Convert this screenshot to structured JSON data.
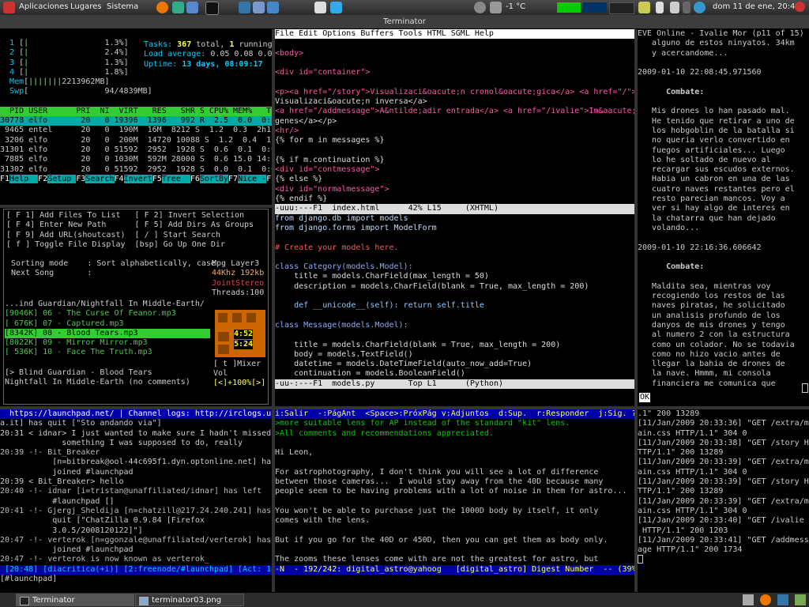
{
  "panel": {
    "menus": [
      "Aplicaciones",
      "Lugares",
      "Sistema"
    ],
    "temperature": "-1 °C",
    "clock": "dom 11 de ene, 20:48"
  },
  "window_title": "Terminator",
  "taskbar": {
    "tasks": [
      "Terminator",
      "terminator03.png"
    ]
  },
  "htop": {
    "cpus": [
      {
        "n": "1",
        "pct": "1.3%"
      },
      {
        "n": "2",
        "pct": "2.4%"
      },
      {
        "n": "3",
        "pct": "1.3%"
      },
      {
        "n": "4",
        "pct": "1.8%"
      }
    ],
    "mem": "3962MB",
    "mem_pre": "221",
    "swp": "94/4839MB",
    "tasks_label": "Tasks:",
    "tasks_total": "367",
    "tasks_mid": " total, ",
    "tasks_running": "1",
    "tasks_end": " running",
    "load_label": "Load average:",
    "load": "0.05 0.08 0.0",
    "uptime_label": "Uptime:",
    "uptime": "13 days, 08:09:17",
    "header": "  PID USER      PRI  NI  VIRT   RES   SHR S CPU% MEM%   TIME",
    "rows": [
      "30778 elfo       20   0 19396  1396   992 R  2.5  0.0  0:36",
      " 9465 entel      20   0  190M  16M  8212 S  1.2  0.3  2h11",
      " 3206 elfo       20   0  200M  14720 10088 S  1.2  0.4  1h57",
      "31301 elfo       20   0 51592  2952  1928 S  0.6  0.1  0:08",
      " 7885 elfo       20   0 1030M  592M 28000 S  0.6 15.0 14:10",
      "31302 elfo       20   0 51592  2952  1928 S  0.0  0.1  0:07"
    ],
    "fkeys": [
      {
        "k": "F1",
        "l": "Help  "
      },
      {
        "k": "F2",
        "l": "Setup "
      },
      {
        "k": "F3",
        "l": "Search"
      },
      {
        "k": "F4",
        "l": "Invert"
      },
      {
        "k": "F5",
        "l": "Tree  "
      },
      {
        "k": "F6",
        "l": "SortBy"
      },
      {
        "k": "F7",
        "l": "Nice -"
      },
      {
        "k": "F8",
        "l": ""
      }
    ]
  },
  "player": {
    "menu": [
      "[ F 1] Add Files To List   [ F 2] Invert Selection",
      "[ F 4] Enter New Path      [ F 5] Add Dirs As Groups",
      "[ F 9] Add URL(shoutcast)  [ / ] Start Search",
      "[ f ] Toggle File Display  [bsp] Go Up One Dir"
    ],
    "sorting": " Sorting mode    : Sort alphabetically, case",
    "next": " Next Song       :",
    "dir": "...ind Guardian/Nightfall In Middle-Earth/",
    "songs": [
      "[9046K] 06 - The Curse Of Feanor.mp3",
      "[ 676K] 07 - Captured.mp3",
      "[8342K] 08 - Blood Tears.mp3",
      "[8022K] 09 - Mirror Mirror.mp3",
      "[ 536K] 10 - Face The Truth.mp3"
    ],
    "selected_index": 2,
    "now1": "[> Blind Guardian - Blood Tears",
    "now2": "Nightfall In Middle-Earth (no comments)",
    "codec": [
      "Mpg Layer3",
      "44Khz 192kb",
      "JointStereo",
      "Threads:100"
    ],
    "elapsed": "4:52",
    "remain": "5:24",
    "mixer": "[ t ]Mixer",
    "vol_label": "Vol",
    "vol": "[<]+100%[>]"
  },
  "emacs": {
    "menubar": "File Edit Options Buffers Tools HTML SGML Help",
    "html_lines": [
      "",
      "<body>",
      "",
      "<div id=\"container\">",
      "",
      "<p><a href=\"/story\">Visualizaci&oacute;n cronol&oacute;gica</a> <a href=\"/\">\\",
      "Visualizaci&oacute;n inversa</a>",
      "<a href=\"/addmessage\">A&ntilde;adir entrada</a> <a href=\"/ivalie\">Im&aacute;\\",
      "genes</a></p>",
      "<hr/>",
      "{% for m in messages %}",
      "",
      "{% if m.continuation %}",
      "<div id=\"contmessage\">",
      "{% else %}",
      "<div id=\"normalmessage\">",
      "{% endif %}"
    ],
    "mode1": "-uuu:---F1  index.html      42% L15     (XHTML)",
    "py_lines": [
      "from django.db import models",
      "from django.forms import ModelForm",
      "",
      "# Create your models here.",
      "",
      "class Category(models.Model):",
      "    title = models.CharField(max_length = 50)",
      "    description = models.CharField(blank = True, max_length = 200)",
      "",
      "    def __unicode__(self): return self.title",
      "",
      "class Message(models.Model):",
      "",
      "    title = models.CharField(blank = True, max_length = 200)",
      "    body = models.TextField()",
      "    datetime = models.DateTimeField(auto_now_add=True)",
      "    continuation = models.BooleanField()"
    ],
    "mode2": "-uu-:---F1  models.py       Top L1      (Python)"
  },
  "eve": {
    "lines": [
      "EVE Online - Ivalie Mor (p11 of 15)",
      "   alguno de estos ninyatos. 34km",
      "   y acercandome...",
      "",
      "2009-01-10 22:08:45.971560",
      "",
      "      Combate:",
      "",
      "   Mis drones lo han pasado mal.",
      "   He tenido que retirar a uno de",
      "   los hobgoblin de la batalla si",
      "   no queria verlo convertido en",
      "   fuegos artificiales... Luego",
      "   lo he soltado de nuevo al",
      "   recargar sus escudos externos.",
      "   Habia un cabron en una de las",
      "   cuatro naves restantes pero el",
      "   resto parecian mancos. Voy a",
      "   ver si hay algo de interes en",
      "   la chatarra que han dejado",
      "   volando...",
      "",
      "2009-01-10 22:16:36.606642",
      "",
      "      Combate:",
      "",
      "   Maldita sea, mientras voy",
      "   recogiendo los restos de las",
      "   naves piratas, he solicitado",
      "   un analisis profundo de los",
      "   danyos de mis drones y tengo",
      "   al numero 2 con la estructura",
      "   como un colador. No se todavia",
      "   como no hizo vacio antes de",
      "   llegar la bahia de drones de",
      "   la nave. Hmmm, mi consola",
      "   financiera me comunica que"
    ],
    "ok": "OK"
  },
  "irc": {
    "topic": "  https://launchpad.net/ | Channel logs: http://irclogs.ub",
    "lines": [
      "a.it] has quit [\"Sto andando via\"]",
      "20:31 < idnar> I just wanted to make sure I hadn't missed",
      "             something I was supposed to do, really",
      "20:39 -!- Bit_Breaker",
      "           [n=bitbreak@ool-44c695f1.dyn.optonline.net] has",
      "           joined #launchpad",
      "20:39 < Bit_Breaker> hello",
      "20:40 -!- idnar [i=tristan@unaffiliated/idnar] has left",
      "           #launchpad []",
      "20:41 -!- Gjergj_Sheldija [n=chatzill@217.24.240.241] has",
      "           quit [\"ChatZilla 0.9.84 [Firefox",
      "           3.0.5/2008120122]\"]",
      "20:47 -!- verterok [n=ggonzale@unaffiliated/verterok] has",
      "           joined #launchpad",
      "20:47 -!- verterok is now known as verterok_"
    ],
    "status": " [20:48] [diacritica(+i)] [2:freenode/#launchpad] [Act: 1]",
    "input": "[#launchpad] "
  },
  "mutt": {
    "top": "i:Salir  -:PágAnt  <Space>:PróxPág v:Adjuntos  d:Sup.  r:Responder  j:Sig. ?:",
    "lines": [
      ">more suitable lens for AP instead of the standard \"kit\" lens.",
      ">All comments and recommendations appreciated.",
      "",
      "Hi Leon,",
      "",
      "For astrophotography, I don't think you will see a lot of difference",
      "between those cameras...  I would stay away from the 40D because many",
      "people seem to be having problems with a lot of noise in them for astro...",
      "",
      "You won't be able to purchase just the 1000D body by itself, it only",
      "comes with the lens.",
      "",
      "But if you go for the 40D or 450D, then you can get them as body only.",
      "",
      "The zooms these lenses come with are not the greatest for astro, but"
    ],
    "status": "-N  - 192/242: digital_astro@yahoog   [digital_astro] Digest Number  -- (39%)"
  },
  "log": {
    "lines": [
      ".1\" 200 13289",
      "[11/Jan/2009 20:33:36] \"GET /extra/m",
      "ain.css HTTP/1.1\" 304 0",
      "[11/Jan/2009 20:33:38] \"GET /story H",
      "TTP/1.1\" 200 13289",
      "[11/Jan/2009 20:33:39] \"GET /extra/m",
      "ain.css HTTP/1.1\" 304 0",
      "[11/Jan/2009 20:33:39] \"GET /story H",
      "TTP/1.1\" 200 13289",
      "[11/Jan/2009 20:33:39] \"GET /extra/m",
      "ain.css HTTP/1.1\" 304 0",
      "[11/Jan/2009 20:33:40] \"GET /ivalie",
      " HTTP/1.1\" 200 1203",
      "[11/Jan/2009 20:33:41] \"GET /addmess",
      "age HTTP/1.1\" 200 1734"
    ]
  }
}
